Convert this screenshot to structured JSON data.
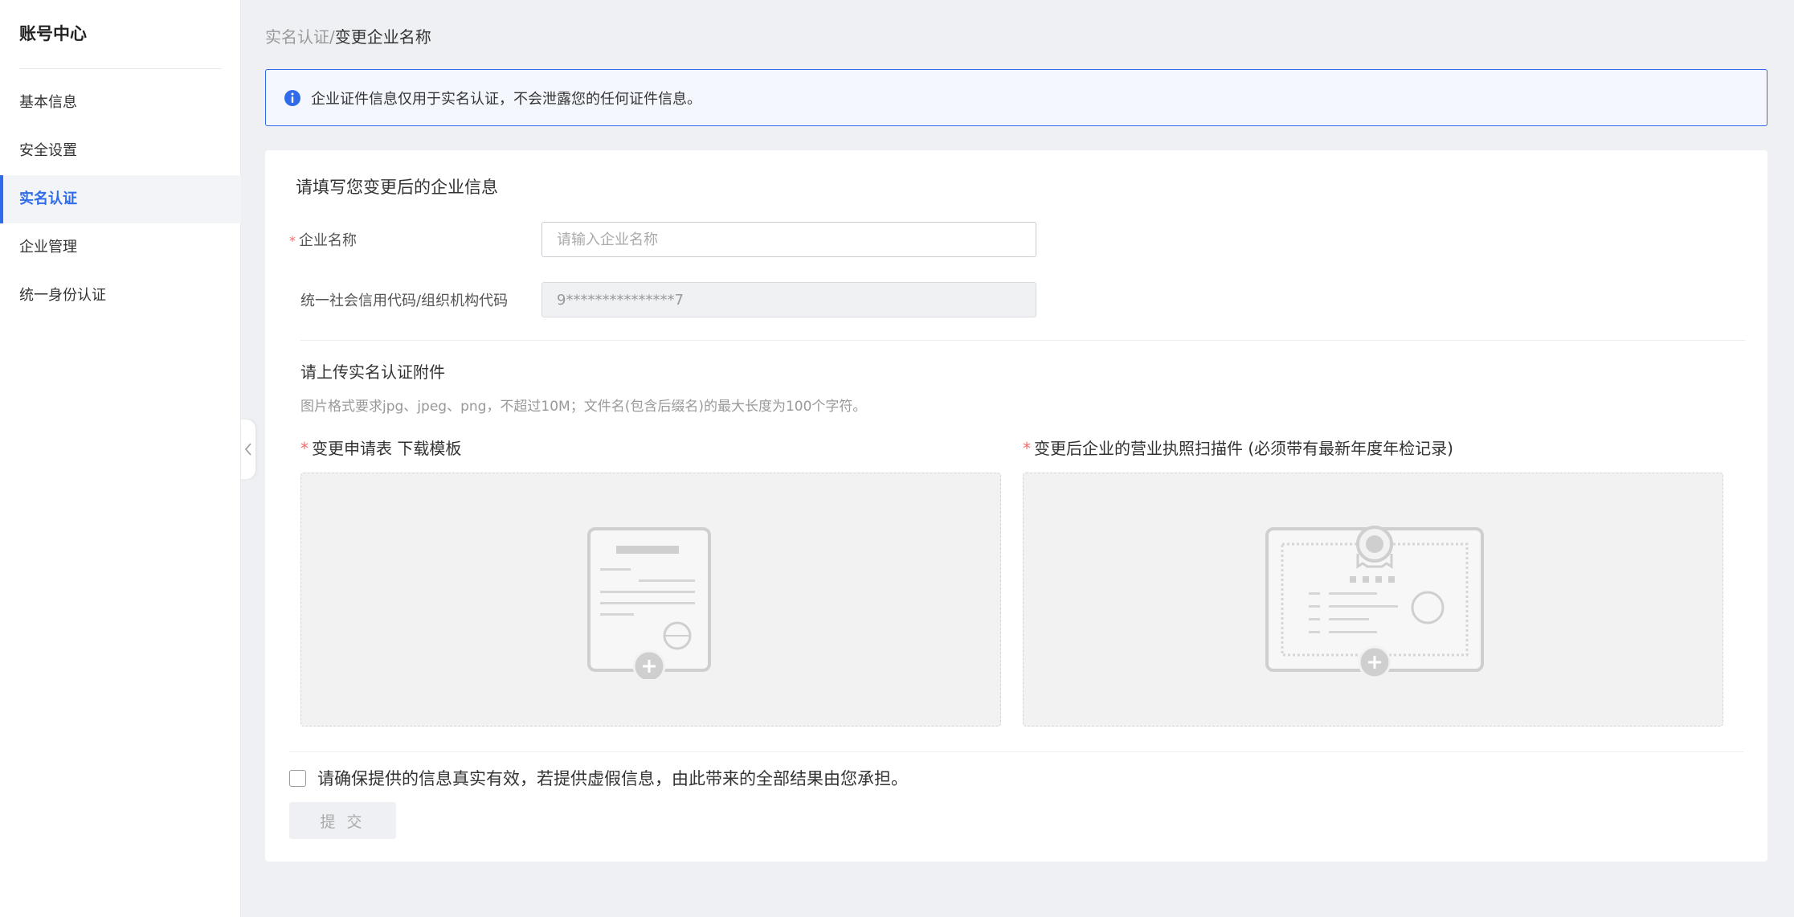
{
  "sidebar": {
    "title": "账号中心",
    "items": [
      {
        "label": "基本信息",
        "active": false
      },
      {
        "label": "安全设置",
        "active": false
      },
      {
        "label": "实名认证",
        "active": true
      },
      {
        "label": "企业管理",
        "active": false
      },
      {
        "label": "统一身份认证",
        "active": false
      }
    ]
  },
  "breadcrumb": {
    "parent": "实名认证",
    "separator": "/",
    "current": "变更企业名称"
  },
  "notice": {
    "icon": "info-icon",
    "text": "企业证件信息仅用于实名认证，不会泄露您的任何证件信息。"
  },
  "form": {
    "section_title": "请填写您变更后的企业信息",
    "company_name": {
      "required_mark": "*",
      "label": "企业名称",
      "placeholder": "请输入企业名称",
      "value": ""
    },
    "credit_code": {
      "label": "统一社会信用代码/组织机构代码",
      "value": "9***************7"
    }
  },
  "upload": {
    "section_title": "请上传实名认证附件",
    "hint": "图片格式要求jpg、jpeg、png，不超过10M；文件名(包含后缀名)的最大长度为100个字符。",
    "application_form": {
      "required_mark": "*",
      "label": "变更申请表",
      "template_link": "下载模板"
    },
    "business_license": {
      "required_mark": "*",
      "label": "变更后企业的营业执照扫描件 (必须带有最新年度年检记录)"
    }
  },
  "agreement": {
    "checked": false,
    "text": "请确保提供的信息真实有效，若提供虚假信息，由此带来的全部结果由您承担。"
  },
  "submit": {
    "label": "提 交"
  },
  "colors": {
    "accent": "#2f6bea",
    "required": "#f56c6c"
  }
}
